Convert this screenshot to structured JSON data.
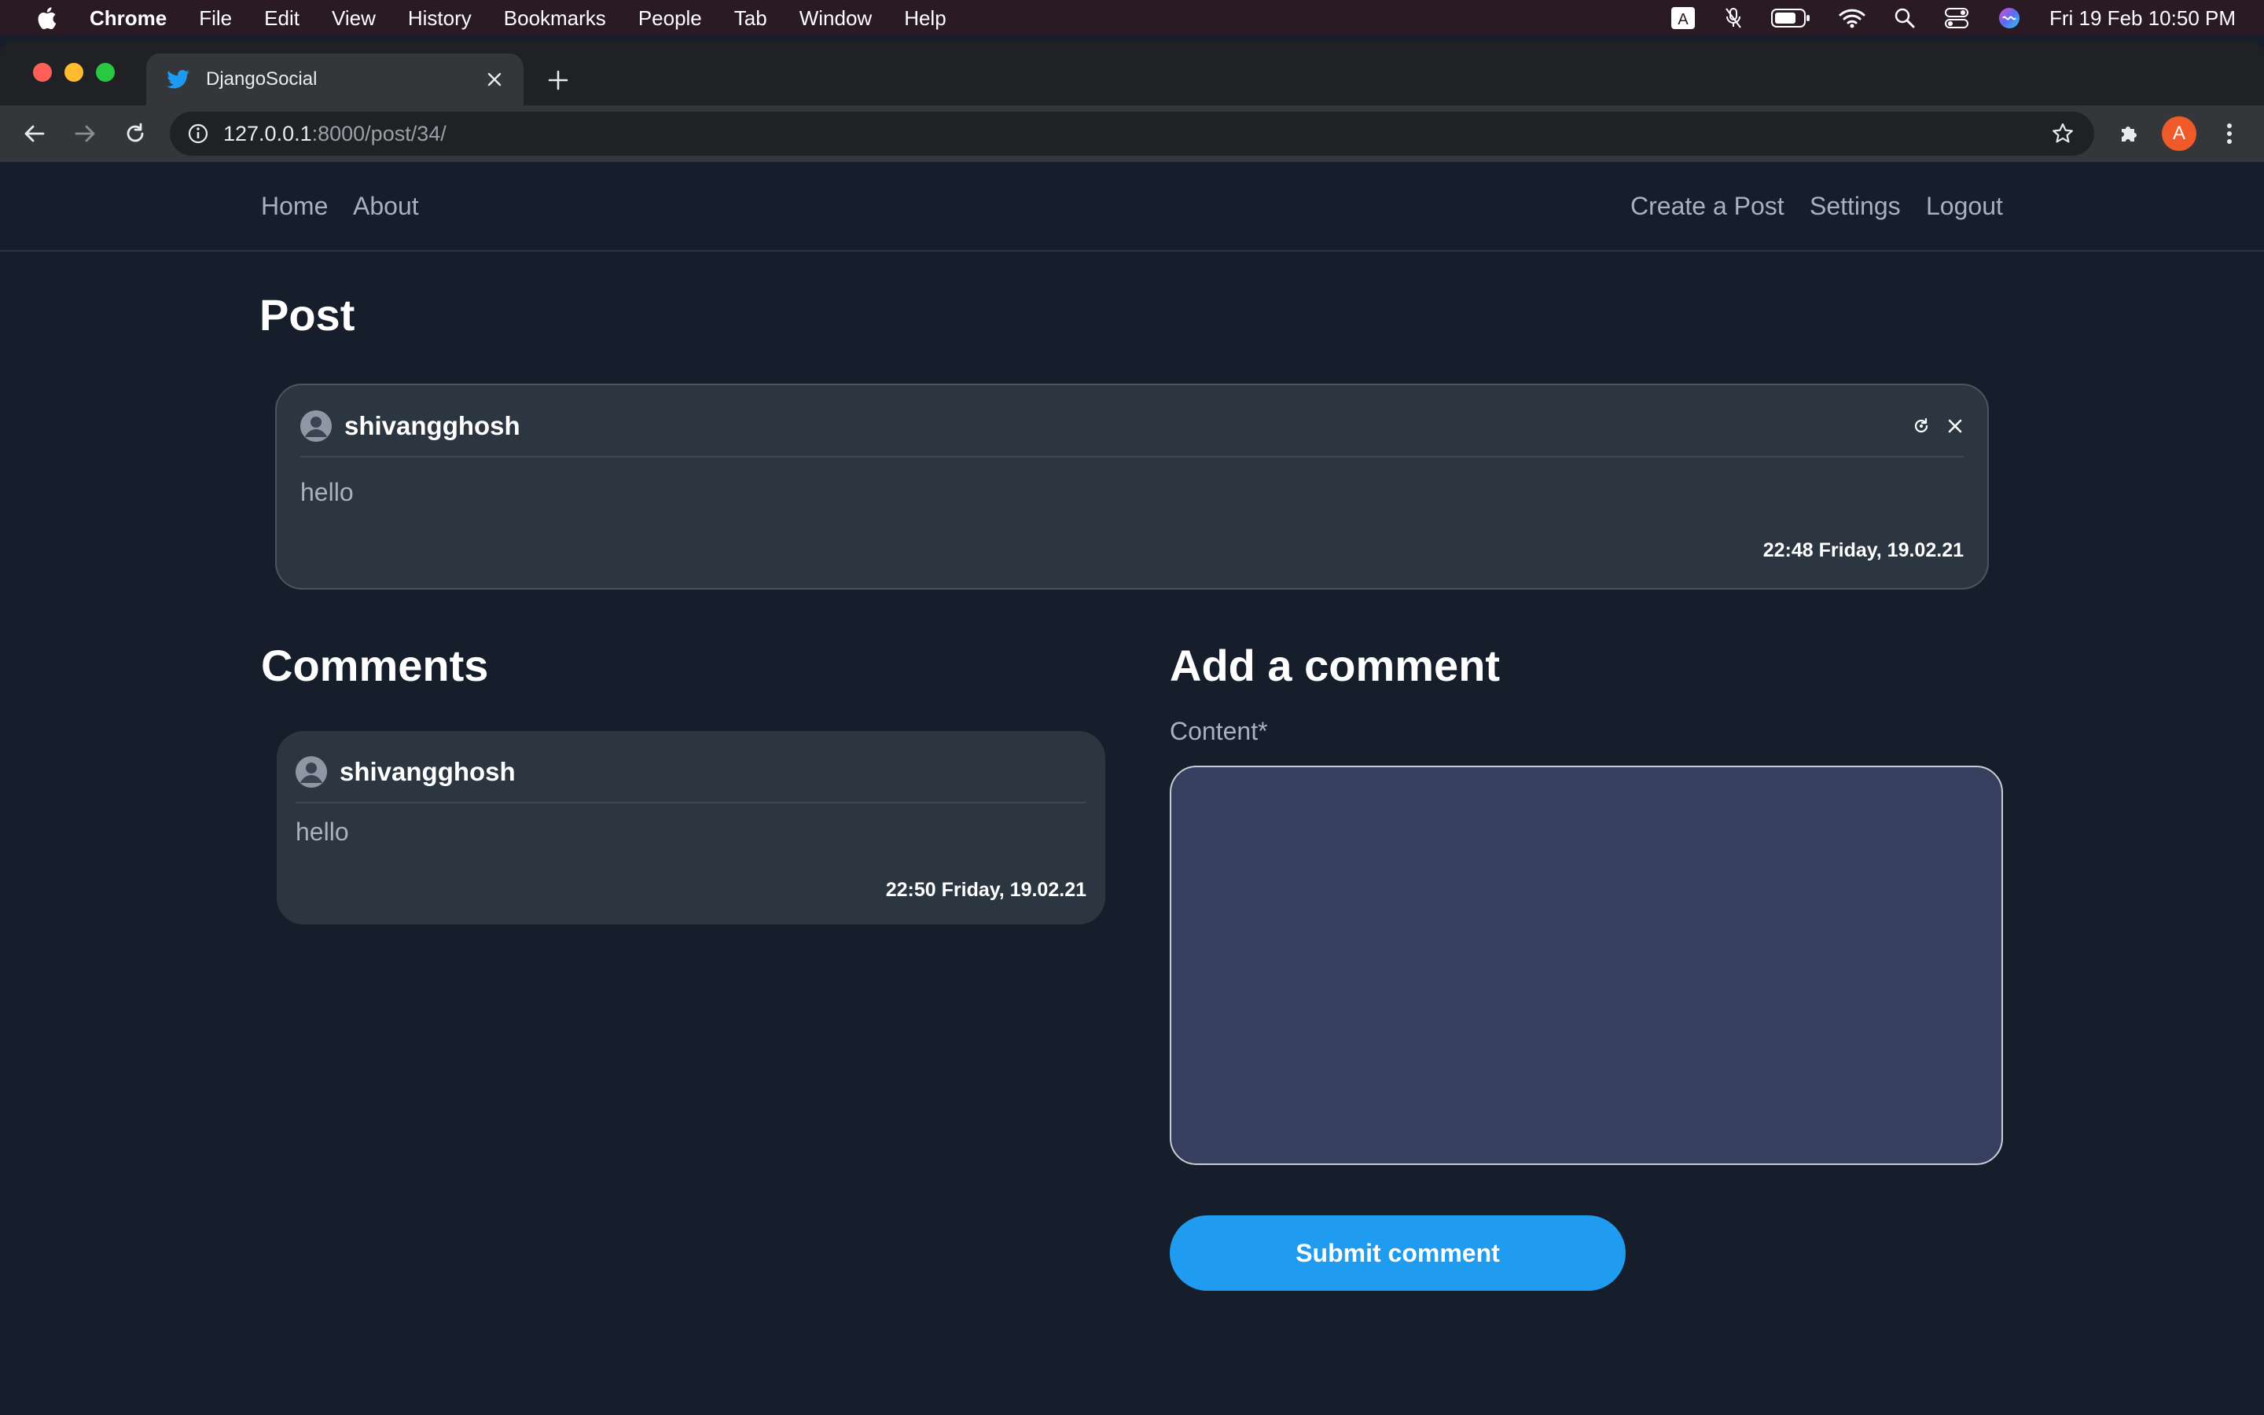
{
  "menubar": {
    "items": [
      "Chrome",
      "File",
      "Edit",
      "View",
      "History",
      "Bookmarks",
      "People",
      "Tab",
      "Window",
      "Help"
    ],
    "clock": "Fri 19 Feb  10:50 PM",
    "input_source": "A"
  },
  "browser": {
    "tab_title": "DjangoSocial",
    "url_host": "127.0.0.1",
    "url_rest": ":8000/post/34/",
    "profile_initial": "A"
  },
  "nav": {
    "home": "Home",
    "about": "About",
    "create_post": "Create a Post",
    "settings": "Settings",
    "logout": "Logout"
  },
  "post": {
    "heading": "Post",
    "username": "shivangghosh",
    "content": "hello",
    "timestamp": "22:48 Friday, 19.02.21"
  },
  "comments": {
    "heading": "Comments",
    "items": [
      {
        "username": "shivangghosh",
        "content": "hello",
        "timestamp": "22:50 Friday, 19.02.21"
      }
    ]
  },
  "add_comment": {
    "heading": "Add a comment",
    "label": "Content*",
    "value": "",
    "submit_label": "Submit comment"
  },
  "colors": {
    "accent": "#1f9bf0",
    "page_bg": "#151e2a",
    "card_bg": "#2c3641",
    "textarea_bg": "#363f5e",
    "profile": "#f05a28"
  }
}
